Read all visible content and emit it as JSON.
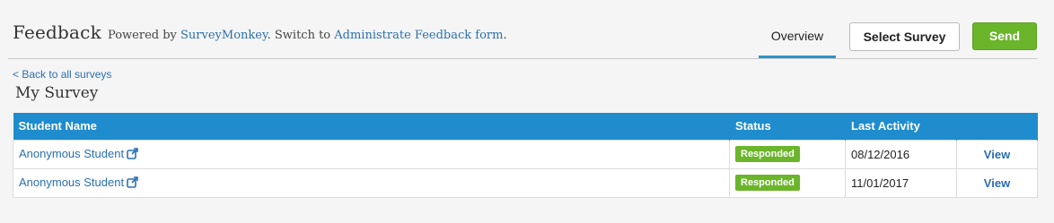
{
  "header": {
    "title": "Feedback",
    "powered_prefix": "Powered by ",
    "powered_link": "SurveyMonkey",
    "switch_text": ". Switch to ",
    "switch_link": "Administrate Feedback form",
    "switch_suffix": "."
  },
  "tabs": {
    "overview": "Overview"
  },
  "buttons": {
    "select_survey": "Select Survey",
    "send": "Send"
  },
  "back_link": "< Back to all surveys",
  "survey_title": "My Survey",
  "table": {
    "headers": {
      "name": "Student Name",
      "status": "Status",
      "activity": "Last Activity",
      "action": ""
    },
    "rows": [
      {
        "name": "Anonymous Student",
        "status": "Responded",
        "activity": "08/12/2016",
        "action": "View"
      },
      {
        "name": "Anonymous Student",
        "status": "Responded",
        "activity": "11/01/2017",
        "action": "View"
      }
    ]
  },
  "colors": {
    "accent": "#1f8ccd",
    "success": "#6bb52a",
    "link": "#2a6fb1"
  },
  "icons": {
    "external": "external-link-icon"
  }
}
